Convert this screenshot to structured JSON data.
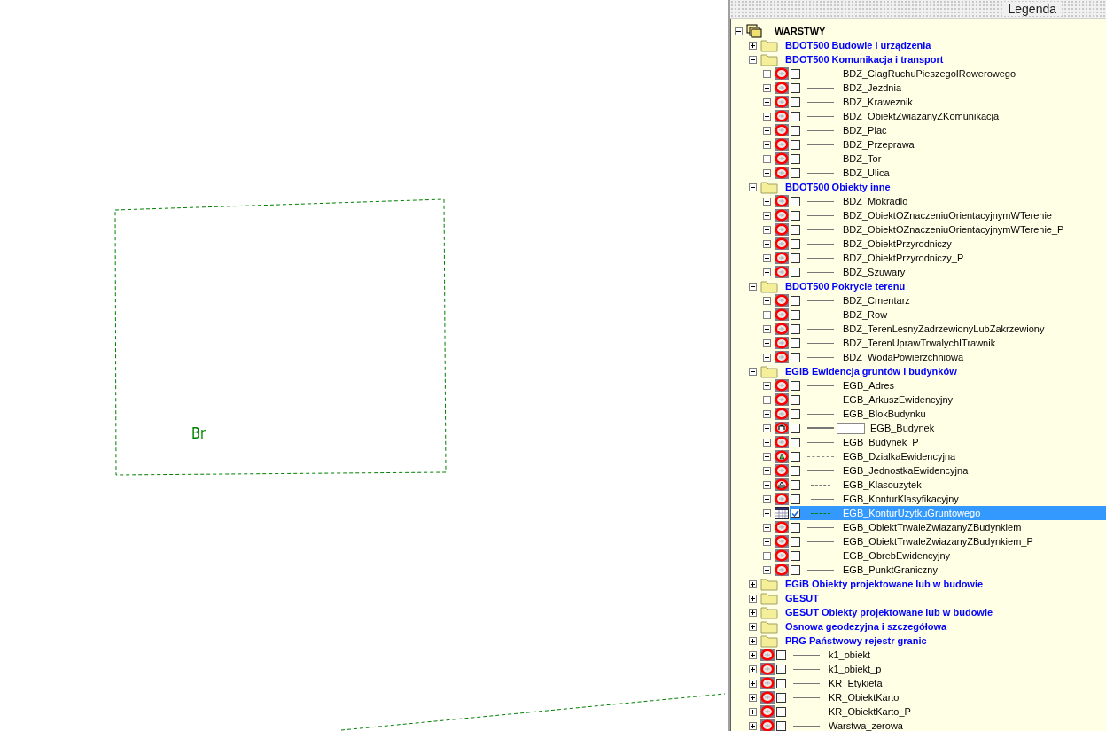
{
  "map": {
    "labels": [
      {
        "text": "Br"
      }
    ]
  },
  "legend": {
    "title": "Legenda",
    "tree": {
      "kind": "root",
      "label": "WARSTWY",
      "expanded": true,
      "children": [
        {
          "kind": "group",
          "label": "BDOT500 Budowle i urządzenia",
          "expanded": false
        },
        {
          "kind": "group",
          "label": "BDOT500 Komunikacja i transport",
          "expanded": true,
          "children": [
            {
              "kind": "layer",
              "label": "BDZ_CiagRuchuPieszegoIRowerowego",
              "checked": false,
              "selected": false,
              "expanded": false
            },
            {
              "kind": "layer",
              "label": "BDZ_Jezdnia",
              "checked": false,
              "selected": false,
              "expanded": false
            },
            {
              "kind": "layer",
              "label": "BDZ_Kraweznik",
              "checked": false,
              "selected": false,
              "expanded": false
            },
            {
              "kind": "layer",
              "label": "BDZ_ObiektZwiazanyZKomunikacja",
              "checked": false,
              "selected": false,
              "expanded": false
            },
            {
              "kind": "layer",
              "label": "BDZ_Plac",
              "checked": false,
              "selected": false,
              "expanded": false
            },
            {
              "kind": "layer",
              "label": "BDZ_Przeprawa",
              "checked": false,
              "selected": false,
              "expanded": false
            },
            {
              "kind": "layer",
              "label": "BDZ_Tor",
              "checked": false,
              "selected": false,
              "expanded": false
            },
            {
              "kind": "layer",
              "label": "BDZ_Ulica",
              "checked": false,
              "selected": false,
              "expanded": false
            }
          ]
        },
        {
          "kind": "group",
          "label": "BDOT500 Obiekty inne",
          "expanded": true,
          "children": [
            {
              "kind": "layer",
              "label": "BDZ_Mokradlo",
              "checked": false,
              "selected": false,
              "expanded": false
            },
            {
              "kind": "layer",
              "label": "BDZ_ObiektOZnaczeniuOrientacyjnymWTerenie",
              "checked": false,
              "selected": false,
              "expanded": false
            },
            {
              "kind": "layer",
              "label": "BDZ_ObiektOZnaczeniuOrientacyjnymWTerenie_P",
              "checked": false,
              "selected": false,
              "expanded": false
            },
            {
              "kind": "layer",
              "label": "BDZ_ObiektPrzyrodniczy",
              "checked": false,
              "selected": false,
              "expanded": false
            },
            {
              "kind": "layer",
              "label": "BDZ_ObiektPrzyrodniczy_P",
              "checked": false,
              "selected": false,
              "expanded": false
            },
            {
              "kind": "layer",
              "label": "BDZ_Szuwary",
              "checked": false,
              "selected": false,
              "expanded": false
            }
          ]
        },
        {
          "kind": "group",
          "label": "BDOT500 Pokrycie terenu",
          "expanded": true,
          "children": [
            {
              "kind": "layer",
              "label": "BDZ_Cmentarz",
              "checked": false,
              "selected": false,
              "expanded": false
            },
            {
              "kind": "layer",
              "label": "BDZ_Row",
              "checked": false,
              "selected": false,
              "expanded": false
            },
            {
              "kind": "layer",
              "label": "BDZ_TerenLesnyZadrzewionyLubZakrzewiony",
              "checked": false,
              "selected": false,
              "expanded": false
            },
            {
              "kind": "layer",
              "label": "BDZ_TerenUprawTrwalychITrawnik",
              "checked": false,
              "selected": false,
              "expanded": false
            },
            {
              "kind": "layer",
              "label": "BDZ_WodaPowierzchniowa",
              "checked": false,
              "selected": false,
              "expanded": false
            }
          ]
        },
        {
          "kind": "group",
          "label": "EGiB Ewidencja gruntów i budynków",
          "expanded": true,
          "children": [
            {
              "kind": "layer",
              "label": "EGB_Adres",
              "checked": false,
              "selected": false,
              "expanded": false
            },
            {
              "kind": "layer",
              "label": "EGB_ArkuszEwidencyjny",
              "checked": false,
              "selected": false,
              "expanded": false
            },
            {
              "kind": "layer",
              "label": "EGB_BlokBudynku",
              "checked": false,
              "selected": false,
              "expanded": false
            },
            {
              "kind": "building",
              "label": "EGB_Budynek",
              "checked": false,
              "selected": false,
              "expanded": false
            },
            {
              "kind": "layer",
              "label": "EGB_Budynek_P",
              "checked": false,
              "selected": false,
              "expanded": false
            },
            {
              "kind": "parcel",
              "label": "EGB_DzialkaEwidencyjna",
              "checked": false,
              "selected": false,
              "expanded": false
            },
            {
              "kind": "layer",
              "label": "EGB_JednostkaEwidencyjna",
              "checked": false,
              "selected": false,
              "expanded": false
            },
            {
              "kind": "landclass",
              "label": "EGB_Klasouzytek",
              "checked": false,
              "selected": false,
              "expanded": false
            },
            {
              "kind": "contour",
              "label": "EGB_KonturKlasyfikacyjny",
              "checked": false,
              "selected": false,
              "expanded": false
            },
            {
              "kind": "landuse",
              "label": "EGB_KonturUzytkuGruntowego",
              "checked": true,
              "selected": true,
              "expanded": false
            },
            {
              "kind": "layer",
              "label": "EGB_ObiektTrwaleZwiazanyZBudynkiem",
              "checked": false,
              "selected": false,
              "expanded": false
            },
            {
              "kind": "layer",
              "label": "EGB_ObiektTrwaleZwiazanyZBudynkiem_P",
              "checked": false,
              "selected": false,
              "expanded": false
            },
            {
              "kind": "layer",
              "label": "EGB_ObrebEwidencyjny",
              "checked": false,
              "selected": false,
              "expanded": false
            },
            {
              "kind": "layer",
              "label": "EGB_PunktGraniczny",
              "checked": false,
              "selected": false,
              "expanded": false
            }
          ]
        },
        {
          "kind": "group",
          "label": "EGiB Obiekty projektowane lub w budowie",
          "expanded": false
        },
        {
          "kind": "group",
          "label": "GESUT",
          "expanded": false
        },
        {
          "kind": "group",
          "label": "GESUT Obiekty projektowane lub w budowie",
          "expanded": false
        },
        {
          "kind": "group",
          "label": "Osnowa geodezyjna i szczegółowa",
          "expanded": false
        },
        {
          "kind": "group",
          "label": "PRG Państwowy rejestr granic",
          "expanded": false
        },
        {
          "kind": "layer",
          "label": "k1_obiekt",
          "checked": false,
          "selected": false,
          "expanded": false
        },
        {
          "kind": "layer",
          "label": "k1_obiekt_p",
          "checked": false,
          "selected": false,
          "expanded": false
        },
        {
          "kind": "layer",
          "label": "KR_Etykieta",
          "checked": false,
          "selected": false,
          "expanded": false
        },
        {
          "kind": "layer",
          "label": "KR_ObiektKarto",
          "checked": false,
          "selected": false,
          "expanded": false
        },
        {
          "kind": "layer",
          "label": "KR_ObiektKarto_P",
          "checked": false,
          "selected": false,
          "expanded": false
        },
        {
          "kind": "layer",
          "label": "Warstwa_zerowa",
          "checked": false,
          "selected": false,
          "expanded": false
        }
      ]
    }
  }
}
